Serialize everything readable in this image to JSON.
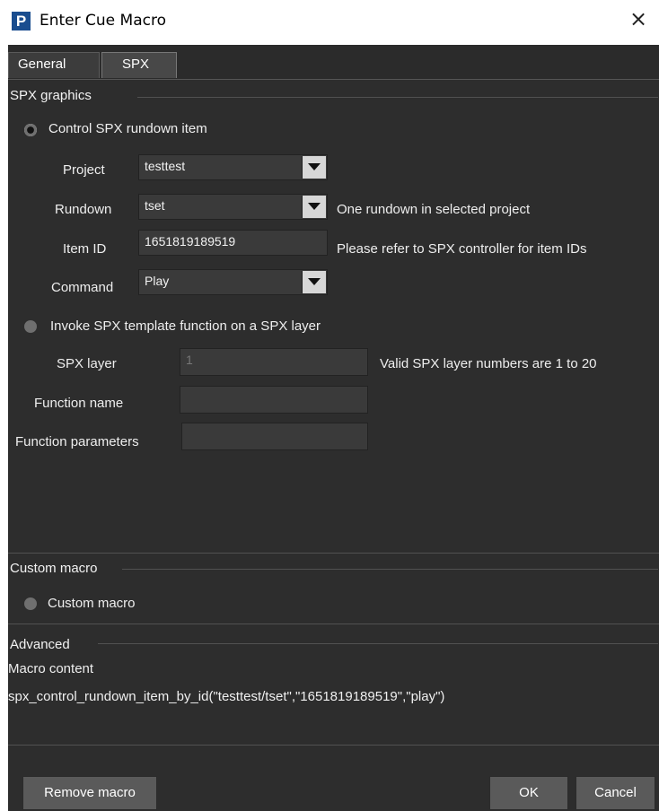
{
  "window": {
    "title": "Enter Cue Macro",
    "logo_letter": "P",
    "close_glyph": "×"
  },
  "tabs": [
    {
      "label": "General",
      "selected": false
    },
    {
      "label": "SPX",
      "selected": true
    }
  ],
  "spx_group": {
    "title": "SPX graphics",
    "control_option": {
      "label": "Control SPX rundown item",
      "checked": true
    },
    "project": {
      "label": "Project",
      "value": "testtest"
    },
    "rundown": {
      "label": "Rundown",
      "value": "tset",
      "hint": "One rundown in selected project"
    },
    "item_id": {
      "label": "Item ID",
      "value": "1651819189519",
      "hint": "Please refer to SPX controller for item IDs"
    },
    "command": {
      "label": "Command",
      "value": "Play"
    },
    "invoke_option": {
      "label": "Invoke SPX template function on a SPX layer",
      "checked": false
    },
    "spx_layer": {
      "label": "SPX layer",
      "value": "1",
      "hint": "Valid SPX layer numbers are 1 to 20"
    },
    "function_name": {
      "label": "Function name",
      "value": ""
    },
    "function_parameters": {
      "label": "Function parameters",
      "value": ""
    }
  },
  "custom_group": {
    "title": "Custom macro",
    "option": {
      "label": "Custom macro",
      "checked": false
    }
  },
  "advanced_group": {
    "title": "Advanced",
    "content_label": "Macro content",
    "content": "spx_control_rundown_item_by_id(\"testtest/tset\",\"1651819189519\",\"play\")"
  },
  "buttons": {
    "remove": "Remove macro",
    "ok": "OK",
    "cancel": "Cancel"
  },
  "colors": {
    "background": "#2d2d2d",
    "field": "#3a3a3a",
    "button": "#5a5a5a",
    "logo": "#1a4d8f"
  }
}
